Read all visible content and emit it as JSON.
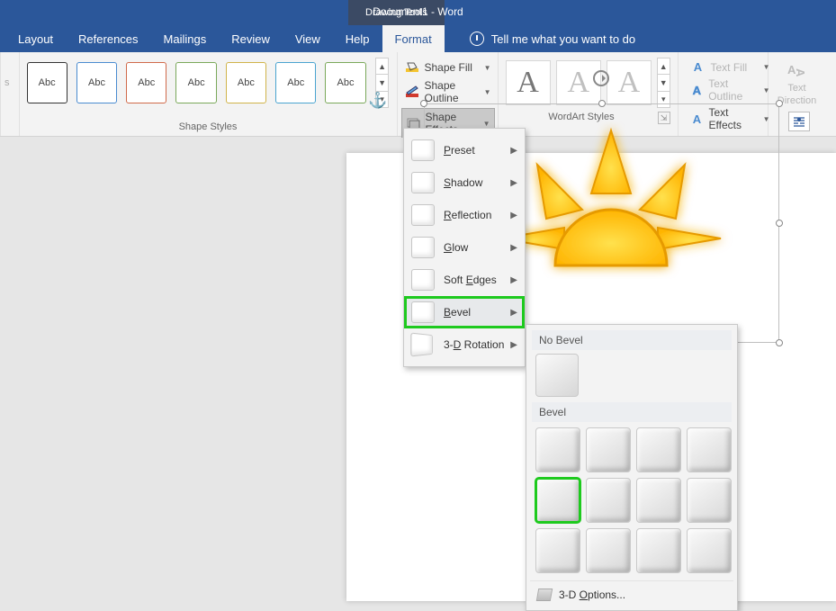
{
  "title": {
    "contextual_tab": "Drawing Tools",
    "document": "Document1  -  Word"
  },
  "tabs": {
    "layout": "Layout",
    "references": "References",
    "mailings": "Mailings",
    "review": "Review",
    "view": "View",
    "help": "Help",
    "format": "Format",
    "tellme": "Tell me what you want to do"
  },
  "shape_styles": {
    "label": "Shape Styles",
    "sample": "Abc",
    "fill": "Shape Fill",
    "outline": "Shape Outline",
    "effects": "Shape Effects"
  },
  "wordart": {
    "label": "WordArt Styles",
    "sample": "A",
    "textfill": "Text Fill",
    "textoutline": "Text Outline",
    "texteffects": "Text Effects"
  },
  "text_group": {
    "direction_top": "Text",
    "direction_bottom": "Direction"
  },
  "effects_menu": {
    "preset": "Preset",
    "shadow": "Shadow",
    "reflection": "Reflection",
    "glow": "Glow",
    "softedges": "Soft Edges",
    "bevel": "Bevel",
    "rotation": "3-D Rotation"
  },
  "bevel_flyout": {
    "no_bevel": "No Bevel",
    "bevel": "Bevel",
    "options": "3-D Options..."
  }
}
